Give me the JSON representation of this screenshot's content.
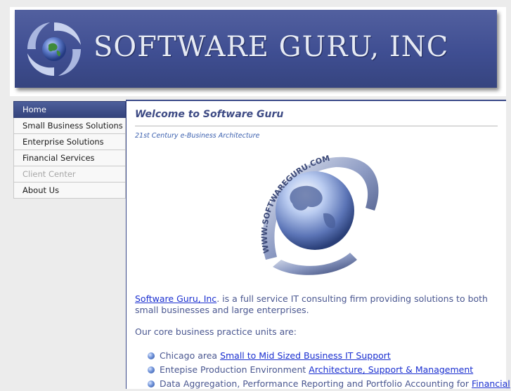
{
  "header": {
    "title": "SOFTWARE GURU, INC",
    "logo_icon": "globe-swirl-icon",
    "colors": {
      "banner": "#3f4e92",
      "title_text": "#e6eaf4"
    }
  },
  "nav": {
    "items": [
      {
        "label": "Home",
        "state": "active"
      },
      {
        "label": "Small Business Solutions",
        "state": "normal"
      },
      {
        "label": "Enterprise Solutions",
        "state": "normal"
      },
      {
        "label": "Financial Services",
        "state": "normal"
      },
      {
        "label": "Client Center",
        "state": "disabled"
      },
      {
        "label": "About Us",
        "state": "normal"
      }
    ]
  },
  "main": {
    "title": "Welcome to Software Guru",
    "subtitle": "21st Century e-Business Architecture",
    "hero_icon": "globe-logo-icon",
    "hero_ring_text": "WWW.SOFTWAREGURU.COM",
    "intro": {
      "link": "Software Guru, Inc",
      "text": ". is a full service IT consulting firm providing solutions to both small businesses and large enterprises."
    },
    "core_label": "Our core business practice units are:",
    "bullets": [
      {
        "text": "Chicago area ",
        "link": "Small to Mid Sized Business IT Support"
      },
      {
        "text": "Entepise Production Environment ",
        "link": "Architecture, Support & Management"
      },
      {
        "text": "Data Aggregation, Performance Reporting and Portfolio Accounting for ",
        "link": "Financial"
      }
    ]
  },
  "colors": {
    "accent": "#3a4988",
    "link": "#1a2fd0",
    "body_text": "#4a5790"
  }
}
